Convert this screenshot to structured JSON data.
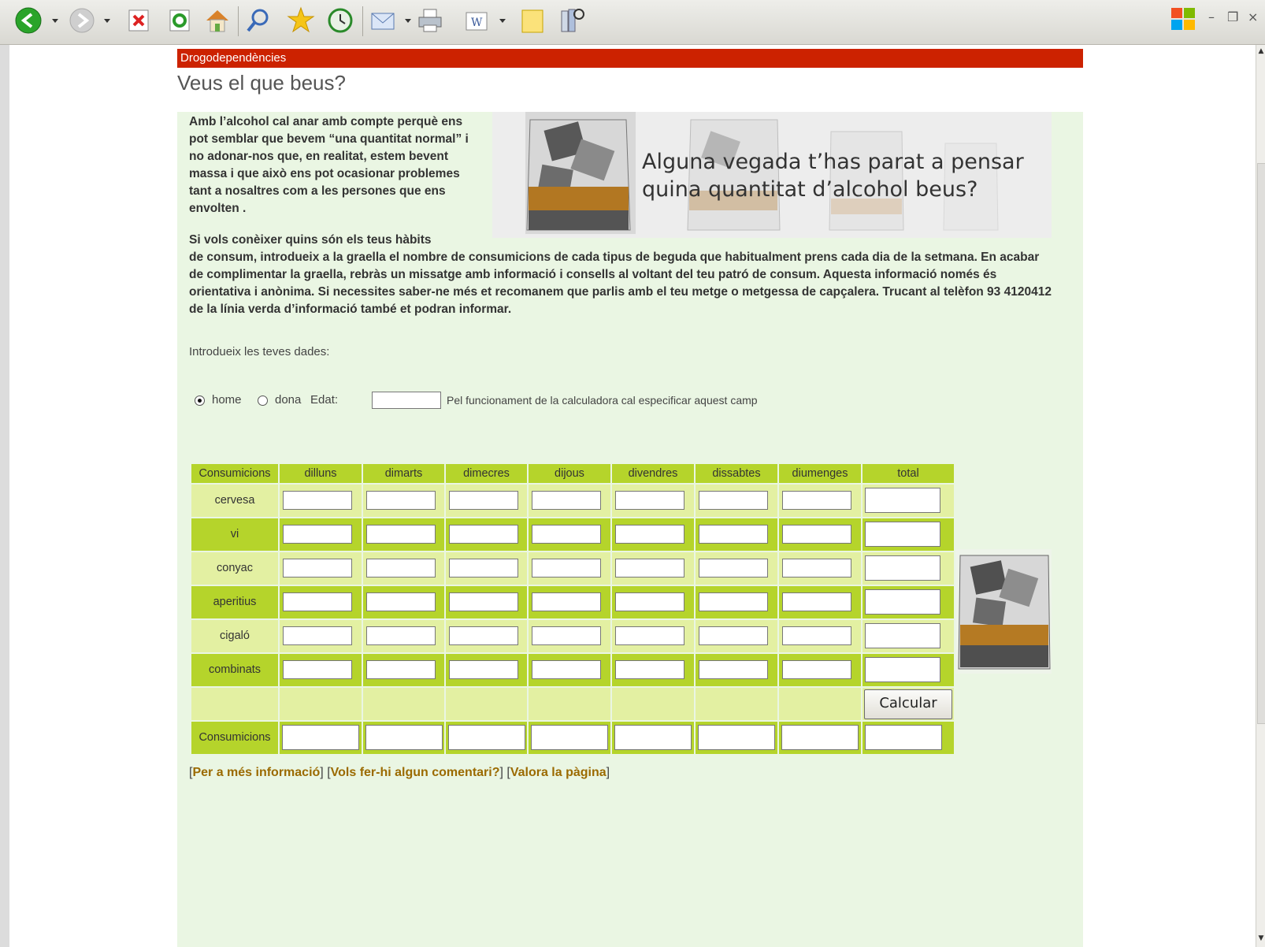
{
  "toolbar": {
    "buttons": [
      "back-icon",
      "forward-icon",
      "stop-icon",
      "refresh-icon",
      "home-icon",
      "search-icon",
      "favorites-icon",
      "history-icon",
      "mail-icon",
      "print-icon",
      "edit-word-icon",
      "notes-icon",
      "research-icon"
    ]
  },
  "page": {
    "section": "Drogodependències",
    "title": "Veus el que beus?",
    "intro_paragraph": "Amb l’alcohol cal anar amb compte perquè ens pot semblar que bevem “una quantitat normal” i no adonar-nos que, en realitat, estem bevent massa i que això ens pot ocasionar problemes tant a nosaltres com a les persones que ens envolten .",
    "second_lead": "Si vols conèixer quins són els teus hàbits",
    "second_paragraph": "de consum, introdueix a la graella el nombre de consumicions de cada tipus de beguda que habitualment prens cada dia de la setmana. En acabar de complimentar la graella, rebràs un missatge amb informació i consells al voltant del teu patró de consum. Aquesta informació només és orientativa i anònima. Si necessites saber-ne més et recomanem que parlis amb el teu metge o metgessa de capçalera. Trucant al telèfon 93 4120412 de la línia verda d’informació també et podran informar.",
    "banner_text": "Alguna vegada t’has parat a pensar quina quantitat d’alcohol beus?",
    "dades_label": "Introdueix les teves dades:"
  },
  "form": {
    "sex_options": [
      "home",
      "dona"
    ],
    "sex_selected": "home",
    "age_label": "Edat:",
    "age_value": "",
    "age_note": "Pel funcionament de la calculadora cal especificar aquest camp"
  },
  "grid": {
    "corner_header": "Consumicions",
    "days": [
      "dilluns",
      "dimarts",
      "dimecres",
      "dijous",
      "divendres",
      "dissabtes",
      "diumenges"
    ],
    "total_header": "total",
    "drinks": [
      "cervesa",
      "vi",
      "conyac",
      "aperitius",
      "cigaló",
      "combinats"
    ],
    "calc_button": "Calcular",
    "result_label": "Consumicions"
  },
  "footer": {
    "links": [
      "Per a més informació",
      "Vols fer-hi algun comentari?",
      "Valora la pàgina"
    ]
  },
  "colors": {
    "section_bar": "#cc2200",
    "content_bg": "#eaf6e3",
    "grid_dark": "#b5d42b",
    "grid_light": "#e3f0a2",
    "link": "#9b6a00"
  }
}
